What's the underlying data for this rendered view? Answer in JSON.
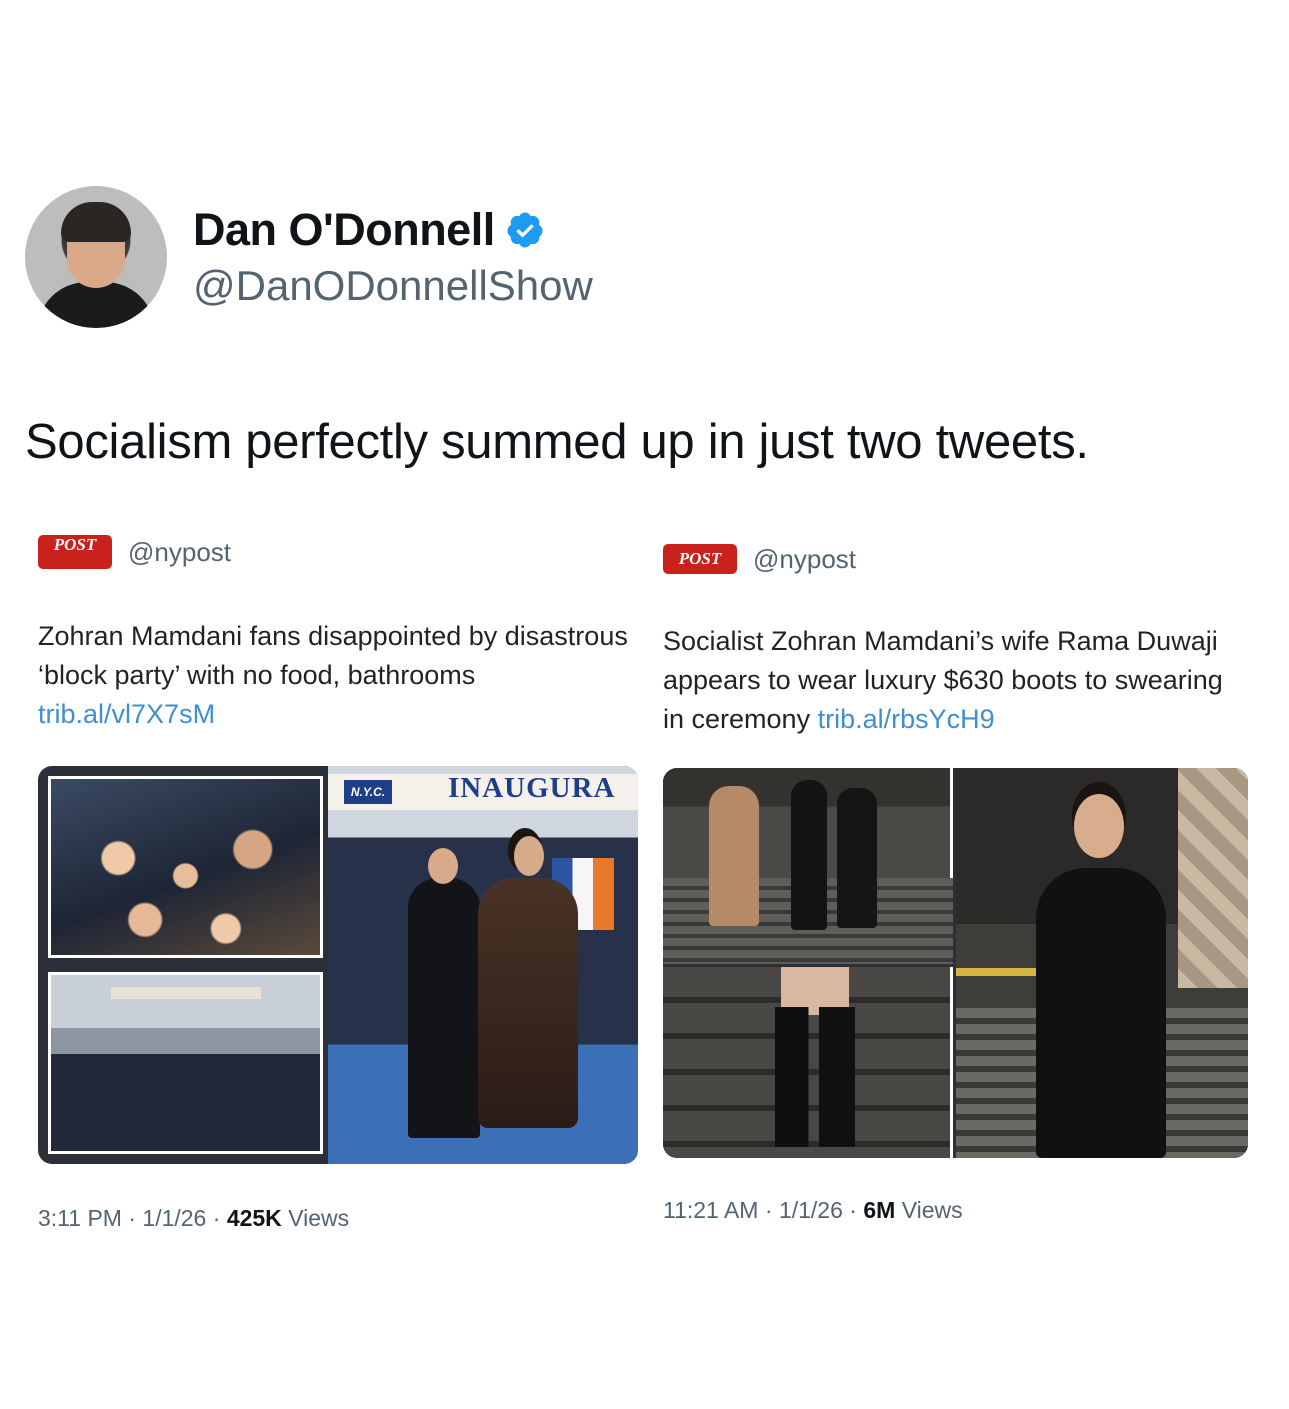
{
  "author": {
    "display_name": "Dan O'Donnell",
    "handle": "@DanODonnellShow",
    "verified": true
  },
  "tweet": {
    "text": "Socialism perfectly summed up in just two tweets."
  },
  "embedded": [
    {
      "logo_text": "POST",
      "handle": "@nypost",
      "headline": "Zohran Mamdani fans disappointed by disastrous ‘block party’ with no food, bathrooms",
      "link": "trib.al/vl7X7sM",
      "photo_banner": "INAUGURA",
      "photo_badge": "N.Y.C.",
      "time": "3:11 PM",
      "date": "1/1/26",
      "views": "425K",
      "views_label": "Views"
    },
    {
      "logo_text": "POST",
      "handle": "@nypost",
      "headline": "Socialist Zohran Mamdani’s wife Rama Duwaji appears to wear luxury $630 boots to swearing in ceremony",
      "link": "trib.al/rbsYcH9",
      "time": "11:21 AM",
      "date": "1/1/26",
      "views": "6M",
      "views_label": "Views"
    }
  ],
  "colors": {
    "verified_blue": "#1d9bf0",
    "link_blue": "#3f8fd2",
    "post_red": "#c9221c",
    "muted_text": "#536471"
  },
  "icons": {
    "verified": "verified-badge-icon"
  }
}
